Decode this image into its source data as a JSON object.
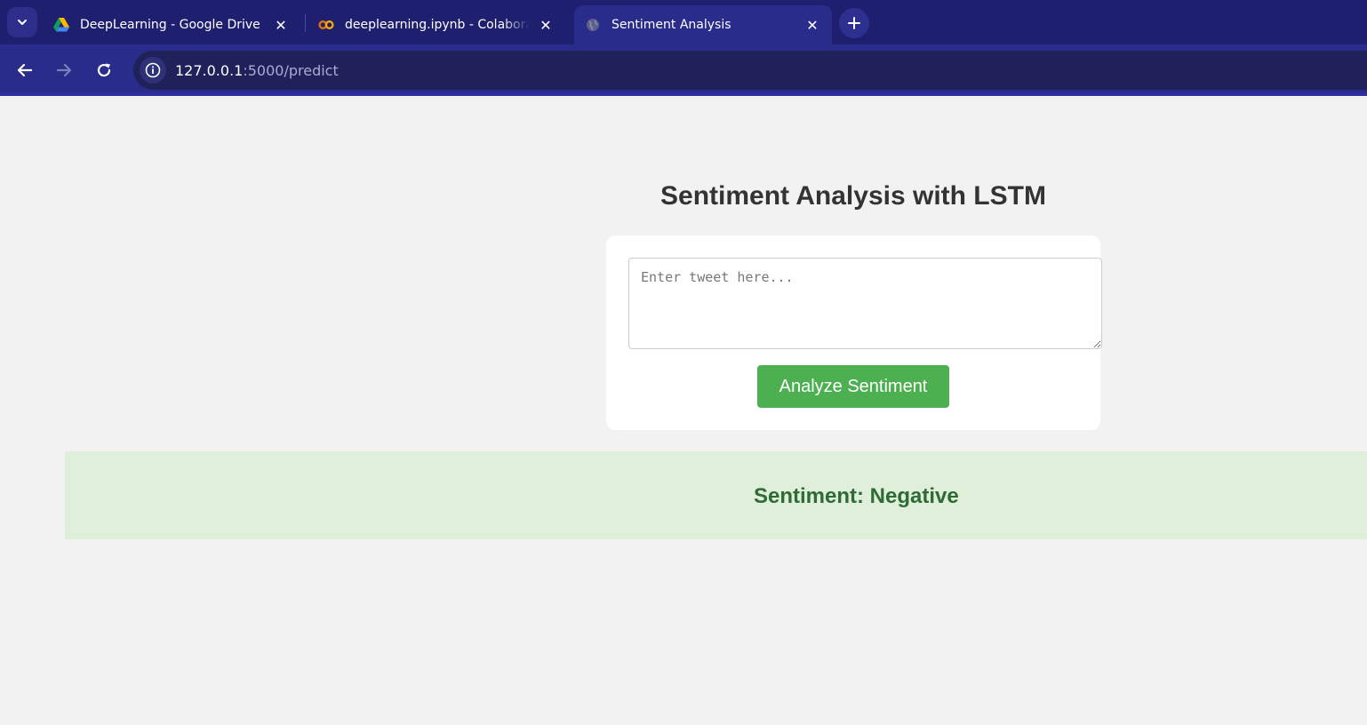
{
  "browser": {
    "tabs": [
      {
        "title": "DeepLearning - Google Drive",
        "icon": "google-drive-icon",
        "active": false
      },
      {
        "title": "deeplearning.ipynb - Colaboratory",
        "icon": "colab-icon",
        "active": false
      },
      {
        "title": "Sentiment Analysis",
        "icon": "globe-icon",
        "active": true
      }
    ],
    "url_host": "127.0.0.1",
    "url_path": ":5000/predict",
    "colors": {
      "tabbar": "#1e1f6e",
      "toolbar": "#2a2c8c",
      "omnibox": "#20215a"
    }
  },
  "page": {
    "heading": "Sentiment Analysis with LSTM",
    "input_placeholder": "Enter tweet here...",
    "input_value": "",
    "button_label": "Analyze Sentiment",
    "result_text": "Sentiment: Negative",
    "colors": {
      "button": "#4caf50",
      "result_bg": "#dfefd9",
      "result_text": "#2e6b36"
    }
  }
}
